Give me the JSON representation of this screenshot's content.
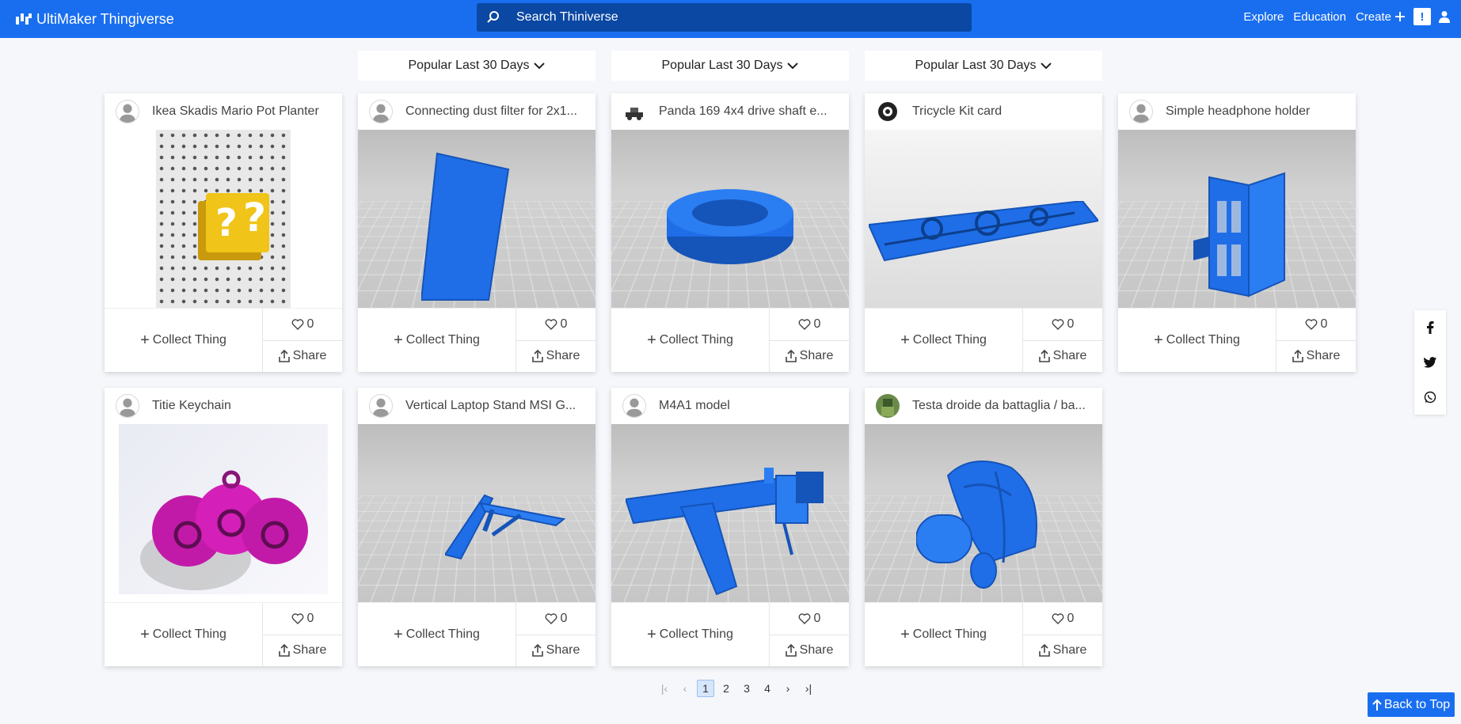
{
  "navbar": {
    "brand": "UltiMaker Thingiverse",
    "search_placeholder": "Search Thiniverse",
    "links": {
      "explore": "Explore",
      "education": "Education",
      "create": "Create"
    },
    "notification_badge": "!"
  },
  "filters": [
    {
      "label": "Popular Last 30 Days"
    },
    {
      "label": "Popular Last 30 Days"
    },
    {
      "label": "Popular Last 30 Days"
    }
  ],
  "cards": [
    {
      "title": "Ikea Skadis Mario Pot Planter",
      "likes": "0",
      "collect": "Collect Thing",
      "share": "Share"
    },
    {
      "title": "Connecting dust filter for 2x1...",
      "likes": "0",
      "collect": "Collect Thing",
      "share": "Share"
    },
    {
      "title": "Panda 169 4x4 drive shaft e...",
      "likes": "0",
      "collect": "Collect Thing",
      "share": "Share"
    },
    {
      "title": "Tricycle Kit card",
      "likes": "0",
      "collect": "Collect Thing",
      "share": "Share"
    },
    {
      "title": "Simple headphone holder",
      "likes": "0",
      "collect": "Collect Thing",
      "share": "Share"
    },
    {
      "title": "Titie Keychain",
      "likes": "0",
      "collect": "Collect Thing",
      "share": "Share"
    },
    {
      "title": "Vertical Laptop Stand MSI G...",
      "likes": "0",
      "collect": "Collect Thing",
      "share": "Share"
    },
    {
      "title": "M4A1 model",
      "likes": "0",
      "collect": "Collect Thing",
      "share": "Share"
    },
    {
      "title": "Testa droide da battaglia / ba...",
      "likes": "0",
      "collect": "Collect Thing",
      "share": "Share"
    }
  ],
  "pagination": {
    "pages": [
      "1",
      "2",
      "3",
      "4"
    ],
    "current": "1"
  },
  "back_to_top": "Back to Top",
  "colors": {
    "primary": "#196ef0",
    "search_bg": "#0b48a3",
    "model_blue": "#1f6ee8"
  }
}
